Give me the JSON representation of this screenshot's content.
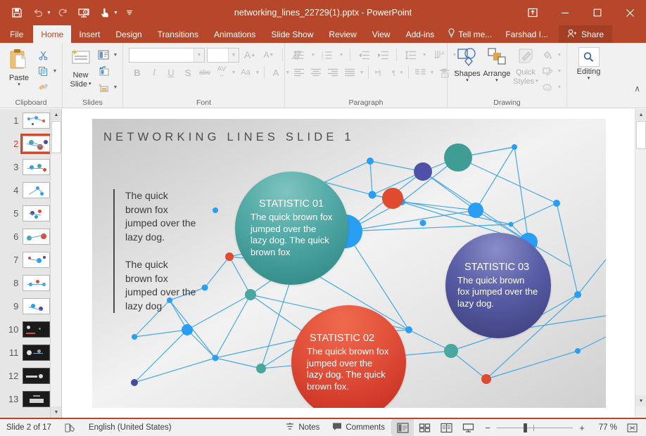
{
  "titlebar": {
    "document_title": "networking_lines_22729(1).pptx - PowerPoint",
    "qat": [
      {
        "name": "save",
        "glyph": "💾",
        "label": "Save"
      },
      {
        "name": "undo",
        "glyph": "↶",
        "label": "Undo"
      },
      {
        "name": "redo",
        "glyph": "↻",
        "label": "Redo"
      },
      {
        "name": "start-presentation",
        "glyph": "⬒",
        "label": "Start From Beginning"
      },
      {
        "name": "touch-mode",
        "glyph": "☝",
        "label": "Touch/Mouse Mode"
      },
      {
        "name": "customize-qat",
        "glyph": "≡",
        "label": "Customize Quick Access Toolbar"
      }
    ],
    "window_controls": [
      {
        "name": "ribbon-display-options",
        "glyph": "⬆",
        "label": "Ribbon Display Options"
      },
      {
        "name": "minimize",
        "glyph": "—",
        "label": "Minimize"
      },
      {
        "name": "restore",
        "glyph": "☐",
        "label": "Restore Down"
      },
      {
        "name": "close",
        "glyph": "✕",
        "label": "Close"
      }
    ]
  },
  "tabs": [
    {
      "label": "File",
      "active": false
    },
    {
      "label": "Home",
      "active": true
    },
    {
      "label": "Insert",
      "active": false
    },
    {
      "label": "Design",
      "active": false
    },
    {
      "label": "Transitions",
      "active": false
    },
    {
      "label": "Animations",
      "active": false
    },
    {
      "label": "Slide Show",
      "active": false
    },
    {
      "label": "Review",
      "active": false
    },
    {
      "label": "View",
      "active": false
    },
    {
      "label": "Add-ins",
      "active": false
    }
  ],
  "tellme": {
    "label": "Tell me..."
  },
  "account": {
    "label": "Farshad I..."
  },
  "share": {
    "label": "Share"
  },
  "ribbon": {
    "clipboard": {
      "label": "Clipboard",
      "paste": {
        "label": "Paste",
        "caret": "▾"
      },
      "cut": {
        "label": "Cut"
      },
      "copy": {
        "label": "Copy"
      },
      "format_painter": {
        "label": "Format Painter"
      }
    },
    "slides": {
      "label": "Slides",
      "new_slide": {
        "label_line1": "New",
        "label_line2": "Slide",
        "caret": "▾"
      },
      "layout": {
        "label": "Layout"
      },
      "reset": {
        "label": "Reset"
      },
      "section": {
        "label": "Section"
      }
    },
    "font": {
      "label": "Font",
      "font_name": {
        "value": "",
        "placeholder": ""
      },
      "font_size": {
        "value": "",
        "placeholder": ""
      },
      "grow_font": {
        "label": "A"
      },
      "shrink_font": {
        "label": "A"
      },
      "clear_formatting": {
        "label": "Clear All Formatting"
      },
      "bold": {
        "label": "B"
      },
      "italic": {
        "label": "I"
      },
      "underline": {
        "label": "U"
      },
      "shadow": {
        "label": "S"
      },
      "strikethrough": {
        "label": "abc"
      },
      "char_spacing": {
        "label": "AV"
      },
      "change_case": {
        "label": "Aa"
      },
      "font_color": {
        "label": "A"
      }
    },
    "paragraph": {
      "label": "Paragraph",
      "bullets": {
        "label": "Bullets"
      },
      "numbering": {
        "label": "Numbering"
      },
      "decrease_indent": {
        "label": "Decrease Indent"
      },
      "increase_indent": {
        "label": "Increase Indent"
      },
      "line_spacing": {
        "label": "Line Spacing"
      },
      "text_direction": {
        "label": "Text Direction"
      },
      "align_text": {
        "label": "Align Text"
      },
      "convert_smartart": {
        "label": "Convert to SmartArt"
      },
      "align_left": {
        "label": "Align Left"
      },
      "center": {
        "label": "Center"
      },
      "align_right": {
        "label": "Align Right"
      },
      "justify": {
        "label": "Justify"
      },
      "ltr": {
        "label": "Left-to-Right"
      },
      "rtl": {
        "label": "Right-to-Left"
      },
      "columns": {
        "label": "Columns"
      }
    },
    "drawing": {
      "label": "Drawing",
      "shapes": {
        "label": "Shapes",
        "caret": "▾"
      },
      "arrange": {
        "label": "Arrange",
        "caret": "▾"
      },
      "quick_styles": {
        "label_line1": "Quick",
        "label_line2": "Styles",
        "caret": "▾"
      },
      "shape_fill": {
        "label": "Shape Fill"
      },
      "shape_outline": {
        "label": "Shape Outline"
      },
      "shape_effects": {
        "label": "Shape Effects"
      }
    },
    "editing": {
      "label": "Editing",
      "button": {
        "label": "Editing",
        "caret": "▾"
      }
    },
    "collapse_ribbon": {
      "glyph": "∧",
      "label": "Collapse the Ribbon"
    }
  },
  "thumbnails": {
    "selected": 2,
    "items": [
      {
        "num": "1",
        "style": "light"
      },
      {
        "num": "2",
        "style": "light"
      },
      {
        "num": "3",
        "style": "light"
      },
      {
        "num": "4",
        "style": "light"
      },
      {
        "num": "5",
        "style": "light"
      },
      {
        "num": "6",
        "style": "light"
      },
      {
        "num": "7",
        "style": "light"
      },
      {
        "num": "8",
        "style": "light"
      },
      {
        "num": "9",
        "style": "light"
      },
      {
        "num": "10",
        "style": "dark"
      },
      {
        "num": "11",
        "style": "dark"
      },
      {
        "num": "12",
        "style": "dark"
      },
      {
        "num": "13",
        "style": "dark"
      }
    ]
  },
  "slide": {
    "title": "NETWORKING LINES SLIDE 1",
    "left_paragraphs": [
      "The quick brown fox jumped over the lazy dog.",
      "The quick brown fox jumped over the lazy dog"
    ],
    "bubbles": [
      {
        "id": "statistic-01",
        "title": "STATISTIC 01",
        "body": "The quick brown fox jumped over the lazy dog. The quick brown fox",
        "color": "#2b8481"
      },
      {
        "id": "statistic-02",
        "title": "STATISTIC 02",
        "body": "The quick brown fox jumped over the lazy dog. The quick brown fox.",
        "color": "#c1271c"
      },
      {
        "id": "statistic-03",
        "title": "STATISTIC 03",
        "body": "The quick brown fox jumped over the lazy dog.",
        "color": "#3a3b78"
      }
    ],
    "network": {
      "line_color": "#3da5e8",
      "node_colors": {
        "blue": "#2a9df4",
        "red": "#e04a2f",
        "teal": "#4aa79f",
        "purple": "#4a4a9c",
        "light_blue": "#38a8ef"
      }
    }
  },
  "statusbar": {
    "slide_indicator": "Slide 2 of 17",
    "language": "English (United States)",
    "notes": "Notes",
    "comments": "Comments",
    "zoom_level": "77 %",
    "views": [
      {
        "name": "normal-view",
        "glyph": "▣",
        "active": true
      },
      {
        "name": "slide-sorter-view",
        "glyph": "☷",
        "active": false
      },
      {
        "name": "reading-view",
        "glyph": "☰",
        "active": false
      },
      {
        "name": "slide-show-view",
        "glyph": "▷",
        "active": false
      }
    ],
    "zoom_out": "−",
    "zoom_in": "+",
    "fit_slide": "⛶"
  }
}
